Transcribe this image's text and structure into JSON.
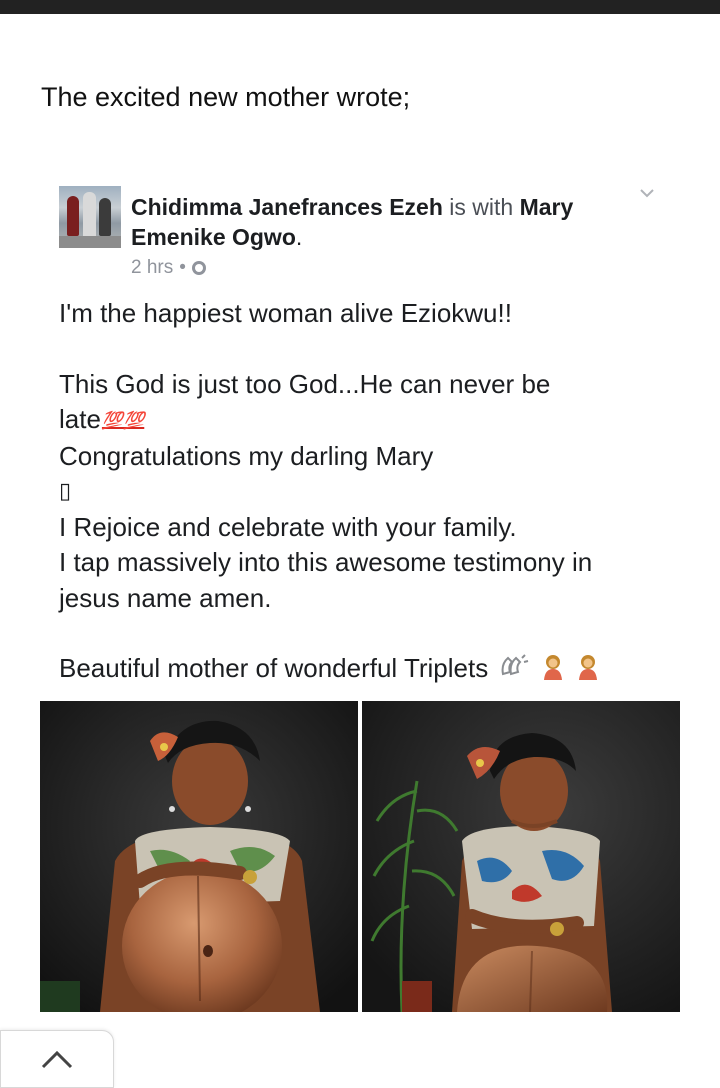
{
  "intro_text": "The excited new mother wrote;",
  "post": {
    "author": "Chidimma Janefrances Ezeh",
    "with_word": "is with",
    "tagged": "Mary Emenike Ogwo",
    "period": ".",
    "time": "2 hrs",
    "separator": "•",
    "privacy_icon": "globe-icon",
    "menu_icon": "chevron-down-icon",
    "lines": {
      "l1": "I'm the happiest woman alive Eziokwu!!",
      "l2a": "This God is just too God...He can never be",
      "l2b": "late",
      "emoji_100": "💯💯",
      "l3": "Congratulations my darling Mary",
      "l4": "▯",
      "l5": "I Rejoice and celebrate with your family.",
      "l6": "I tap massively into this awesome testimony in",
      "l7": "jesus name amen.",
      "l8": "Beautiful mother of wonderful Triplets"
    },
    "trailing_emojis": [
      "clapping-hands-emoji",
      "woman-emoji",
      "woman-emoji"
    ],
    "photos": [
      "pregnant-woman-photo-front",
      "pregnant-woman-photo-side"
    ]
  },
  "colors": {
    "top_bar": "#222222",
    "text": "#1c1e21",
    "meta": "#90949c",
    "emoji_red": "#d9271f"
  },
  "scroll_button_icon": "chevron-up-icon"
}
